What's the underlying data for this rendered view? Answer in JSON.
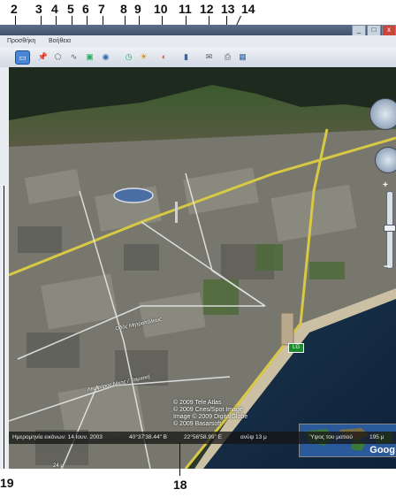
{
  "callouts_top": [
    "2",
    "3",
    "4",
    "5",
    "6",
    "7",
    "8",
    "9",
    "10",
    "11",
    "12",
    "13",
    "14"
  ],
  "callouts_bottom": {
    "left": "19",
    "middle": "18"
  },
  "menu": {
    "items": [
      "Προσθήκη",
      "Βοήθεια"
    ]
  },
  "window_buttons": [
    "_",
    "□",
    "x"
  ],
  "map": {
    "road_label": "Λεωφόρος Νίκης / Τσιμισκή",
    "road_label_2": "Οδός Μητροπόλεως",
    "elevation_marker": "24 μ",
    "placemark_label": "LG"
  },
  "credits": {
    "line1": "© 2009 Tele Atlas",
    "line2": "© 2009 Cnes/Spot Image",
    "line3": "Image © 2009 DigitalGlobe",
    "line4": "© 2009 Basarsoft"
  },
  "status": {
    "imagery_date": "Ημερομηνία εικόνων: 14 Ιουν. 2003",
    "latitude": "40°37'38.44\" Β",
    "longitude": "22°56'58.99\" Ε",
    "elevation": "ανύψ  13 μ",
    "eye_alt_label": "Ύψος του ματιού",
    "eye_alt_value": "195 μ"
  },
  "minimap": {
    "brand": "Goog"
  },
  "icons": [
    "sidebar-toggle-icon",
    "placemark-icon",
    "polygon-icon",
    "path-icon",
    "image-overlay-icon",
    "record-tour-icon",
    "historical-imagery-icon",
    "sunlight-icon",
    "planets-icon",
    "ruler-icon",
    "email-icon",
    "print-icon",
    "view-in-maps-icon"
  ]
}
